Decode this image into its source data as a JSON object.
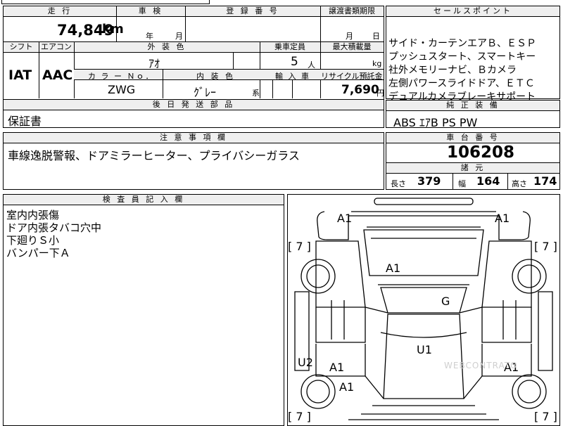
{
  "sheet": {
    "mileage_header": "走 行",
    "mileage_value": "74,849",
    "mileage_unit": "km",
    "inspection_header": "車 検",
    "inspection_year": "年",
    "inspection_month": "月",
    "reg_header": "登 録 番 号",
    "transfer_header": "譲渡書類期限",
    "transfer_month": "月",
    "transfer_day": "日",
    "sales_header": "セールスポイント",
    "sales_points": [
      "サイド・カーテンエアＢ、ＥＳＰ",
      "プッシュスタート、スマートキー",
      "社外メモリーナビ、Ｂカメラ",
      "左側パワースライドドア、ＥＴＣ",
      "デュアルカメラブレーキサポート"
    ],
    "shift_header": "シフト",
    "aircon_header": "エアコン",
    "exterior_header": "外 装 色",
    "seats_header": "乗車定員",
    "max_load_header": "最大積載量",
    "shift_value": "IAT",
    "aircon_value": "AAC",
    "exterior_value": "ｱｵ",
    "seats_value": "5",
    "seats_unit": "人",
    "load_unit": "kg",
    "color_no_header": "カ ラ ー Ｎｏ．",
    "interior_header": "内 装 色",
    "import_header": "輸 入 車",
    "recycle_header": "リサイクル預託金",
    "color_no_value": "ZWG",
    "interior_value": "ｸﾞﾚｰ",
    "interior_suffix": "系",
    "recycle_value": "7,690",
    "recycle_unit": "円",
    "later_parts_header": "後 日 発 送 部 品",
    "later_parts_value": "保証書",
    "genuine_header": "純 正 装 備",
    "genuine_value": "ABS ｴｱB PS PW",
    "notes_header": "注 意 事 項 欄",
    "notes_value": "車線逸脱警報、ドアミラーヒーター、プライバシーガラス",
    "chassis_header": "車 台 番 号",
    "chassis_value": "106208",
    "specs_header": "諸 元",
    "length_label": "長さ",
    "length_value": "379",
    "width_label": "幅",
    "width_value": "164",
    "height_label": "高さ",
    "height_value": "174",
    "inspector_header": "検 査 員 記 入 欄",
    "inspector_notes": [
      "室内内張傷",
      "ドア内張タバコ穴中",
      "下廻りＳ小",
      "バンパー下Ａ"
    ]
  },
  "diagram": {
    "marks": {
      "front_left": "A1",
      "front_right": "A1",
      "bonnet": "A1",
      "windshield": "G",
      "roof": "U1",
      "left_side": "U2",
      "left_door": "A1",
      "left_rear": "A1",
      "right_door": "A1"
    },
    "bracket_labels": [
      "[ 7 ]",
      "[ 7 ]",
      "[ 7 ]",
      "[ 7 ]"
    ],
    "watermark": "WEBCONTRATO"
  }
}
